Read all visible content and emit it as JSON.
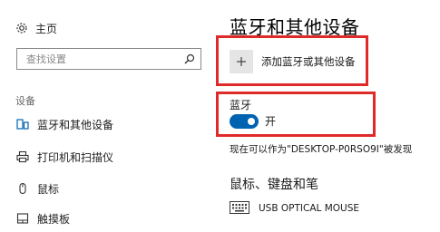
{
  "nav": {
    "home_label": "主页",
    "search_placeholder": "查找设置",
    "section_label": "设备",
    "items": [
      {
        "label": "蓝牙和其他设备",
        "icon": "bluetooth-devices-icon",
        "active": true
      },
      {
        "label": "打印机和扫描仪",
        "icon": "printer-icon",
        "active": false
      },
      {
        "label": "鼠标",
        "icon": "mouse-icon",
        "active": false
      },
      {
        "label": "触摸板",
        "icon": "touchpad-icon",
        "active": false
      }
    ]
  },
  "main": {
    "title": "蓝牙和其他设备",
    "add_device_label": "添加蓝牙或其他设备",
    "bluetooth_title": "蓝牙",
    "toggle_state": "开",
    "discoverable_text": "现在可以作为\"DESKTOP-P0RSO9I\"被发现",
    "section_heading": "鼠标、键盘和笔",
    "devices": [
      {
        "label": "USB OPTICAL MOUSE",
        "icon": "keyboard-icon"
      }
    ]
  },
  "colors": {
    "accent": "#0063b1",
    "highlight": "#e02a2a"
  },
  "icons": {
    "home": "gear-icon",
    "search": "search-icon",
    "add": "plus-icon"
  }
}
